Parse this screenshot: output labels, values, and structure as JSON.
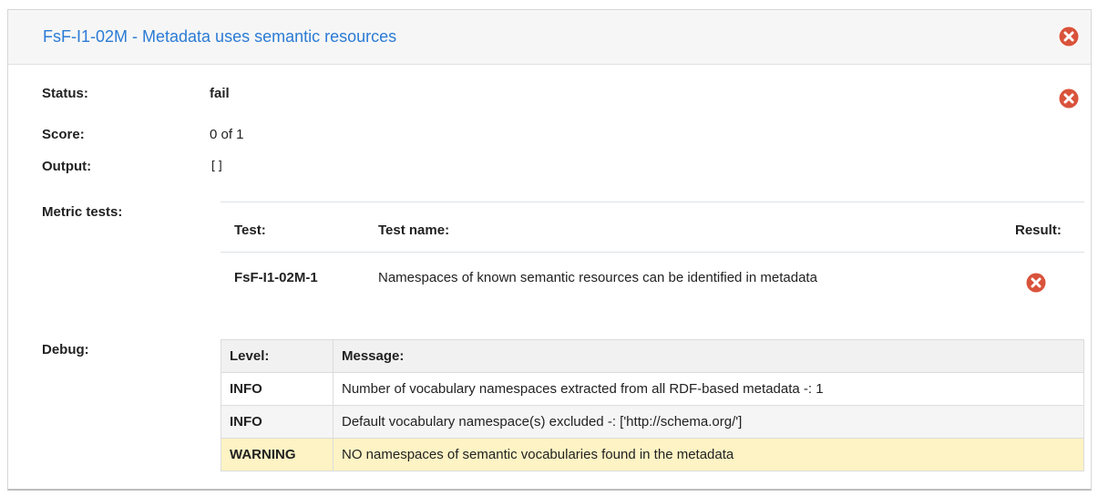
{
  "header": {
    "title": "FsF-I1-02M - Metadata uses semantic resources",
    "status_icon": "times-circle-icon"
  },
  "summary": {
    "status_label": "Status:",
    "status_value": "fail",
    "score_label": "Score:",
    "score_value": "0 of 1",
    "output_label": "Output:",
    "output_value": "[]",
    "metric_tests_label": "Metric tests:",
    "debug_label": "Debug:"
  },
  "metric_tests": {
    "headers": {
      "test": "Test:",
      "name": "Test name:",
      "result": "Result:"
    },
    "rows": [
      {
        "test": "FsF-I1-02M-1",
        "name": "Namespaces of known semantic resources can be identified in metadata",
        "result": "fail"
      }
    ]
  },
  "debug": {
    "headers": {
      "level": "Level:",
      "message": "Message:"
    },
    "rows": [
      {
        "level": "INFO",
        "message": "Number of vocabulary namespaces extracted from all RDF-based metadata -: 1"
      },
      {
        "level": "INFO",
        "message": "Default vocabulary namespace(s) excluded -: ['http://schema.org/']"
      },
      {
        "level": "WARNING",
        "message": "NO namespaces of semantic vocabularies found in the metadata"
      }
    ]
  },
  "colors": {
    "title": "#2b7bd5",
    "fail_icon": "#d9533b",
    "warning_row": "#fdf3c4"
  }
}
